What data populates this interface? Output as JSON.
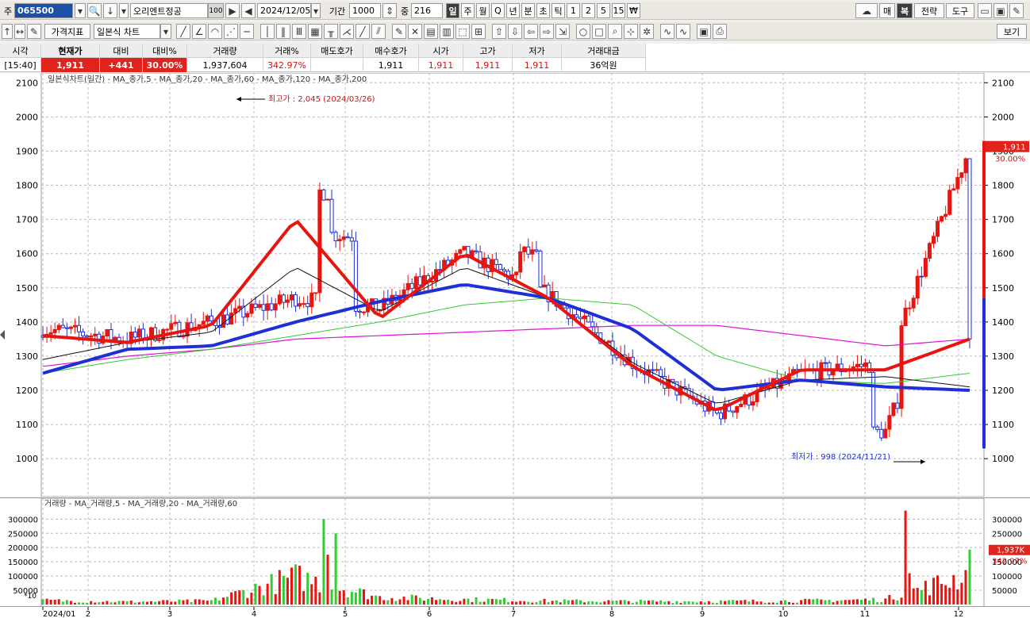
{
  "toolbar1": {
    "market_label": "주",
    "stock_code": "065500",
    "stock_name": "오리엔트정공",
    "name_badge": "100",
    "date": "2024/12/05",
    "period_label": "기간",
    "period_value": "1000",
    "mid_label": "중",
    "mid_value": "216",
    "timeframes": [
      "일",
      "주",
      "월",
      "Q",
      "년",
      "분",
      "초",
      "틱",
      "1",
      "2",
      "5",
      "15",
      "₩"
    ],
    "selected_timeframe": "일",
    "right_buttons": [
      "매",
      "복",
      "전략",
      "도구"
    ]
  },
  "toolbar2": {
    "price_indicator_label": "가격지표",
    "chart_type_value": "일본식 차트",
    "view_button": "보기"
  },
  "quote": {
    "headers": [
      "시각",
      "현재가",
      "대비",
      "대비%",
      "거래량",
      "거래%",
      "매도호가",
      "매수호가",
      "시가",
      "고가",
      "저가",
      "거래대금"
    ],
    "values": [
      "[15:40]",
      "1,911",
      "+441",
      "30.00%",
      "1,937,604",
      "342.97%",
      "",
      "1,911",
      "1,911",
      "1,911",
      "1,911",
      "36억원"
    ]
  },
  "main_legend": {
    "chart_name": "일본식차트(일간)",
    "ma_labels": [
      "MA_종가,5",
      "MA_종가,20",
      "MA_종가,60",
      "MA_종가,120",
      "MA_종가,200"
    ],
    "ma_colors": [
      "#e8140f",
      "#e8140f",
      "#1e2fd6",
      "#33cc33",
      "#e010d8"
    ]
  },
  "annotations": {
    "high_label": "최고가 : 2,045 (2024/03/26)",
    "low_label": "최저가 : 998 (2024/11/21)",
    "current_price_tag": "1,911",
    "current_pct_tag": "30.00%"
  },
  "volume_legend": {
    "chart_name": "거래량",
    "ma_labels": [
      "MA_거래량,5",
      "MA_거래량,20",
      "MA_거래량,60"
    ],
    "ma_colors": [
      "#e8140f",
      "#111111",
      "#33cc33"
    ],
    "scale_tag": "*10",
    "current_volume_tag": "1,937K",
    "current_pct_tag": "342.97%"
  },
  "colors": {
    "up": "#e8140f",
    "down": "#1e2fd6",
    "tag_red": "#e0231c",
    "tag_blue": "#1e2fd6"
  },
  "chart_data": [
    {
      "type": "candlestick",
      "title": "일본식차트(일간)",
      "y_ticks": [
        1000,
        1100,
        1200,
        1300,
        1400,
        1500,
        1600,
        1700,
        1800,
        1900,
        2000,
        2100
      ],
      "ylim": [
        940,
        2110
      ],
      "x_ticks": [
        "2024/01",
        "2",
        "3",
        "4",
        "5",
        "6",
        "7",
        "8",
        "9",
        "10",
        "11",
        "12"
      ],
      "grid": true,
      "close_series_monthly": {
        "x": [
          "2024-01",
          "2024-02",
          "2024-03",
          "2024-04",
          "2024-05",
          "2024-06",
          "2024-07",
          "2024-08",
          "2024-09",
          "2024-10",
          "2024-11",
          "2024-12"
        ],
        "close": [
          1380,
          1350,
          1400,
          1470,
          1440,
          1600,
          1480,
          1280,
          1130,
          1250,
          1280,
          1911
        ]
      },
      "ma_series": {
        "ma5": [
          1360,
          1340,
          1390,
          1700,
          1410,
          1600,
          1470,
          1270,
          1140,
          1260,
          1260,
          1350
        ],
        "ma20": [
          1290,
          1340,
          1370,
          1560,
          1430,
          1560,
          1470,
          1280,
          1160,
          1230,
          1240,
          1210
        ],
        "ma60": [
          1250,
          1320,
          1330,
          1400,
          1460,
          1510,
          1470,
          1380,
          1200,
          1230,
          1210,
          1200
        ],
        "ma120": [
          1250,
          1290,
          1320,
          1360,
          1400,
          1450,
          1470,
          1450,
          1300,
          1230,
          1220,
          1250
        ],
        "ma200": [
          1270,
          1300,
          1320,
          1350,
          1360,
          1370,
          1380,
          1390,
          1390,
          1360,
          1330,
          1350
        ]
      },
      "highest": {
        "value": 2045,
        "date": "2024/03/26"
      },
      "lowest": {
        "value": 998,
        "date": "2024/11/21"
      }
    },
    {
      "type": "bar",
      "title": "거래량",
      "y_ticks": [
        50000,
        100000,
        150000,
        200000,
        250000,
        300000
      ],
      "ylim": [
        0,
        340000
      ],
      "scale": "*10",
      "monthly_peaks": [
        45000,
        30000,
        40000,
        300000,
        80000,
        55000,
        40000,
        35000,
        35000,
        40000,
        55000,
        330000
      ]
    }
  ]
}
